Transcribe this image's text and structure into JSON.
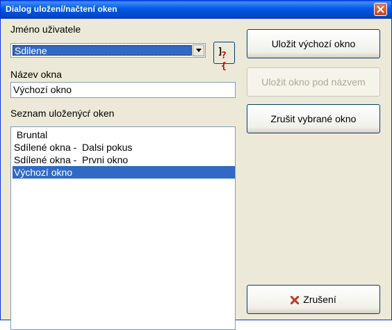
{
  "window": {
    "title": "Dialog uložení/načtení oken"
  },
  "user": {
    "label": "Jméno uživatele",
    "selected": "Sdilene"
  },
  "help_button": {
    "text": "?{"
  },
  "window_name": {
    "label": "Název okna",
    "value": "Výchozí okno"
  },
  "saved_list": {
    "label": "Seznam uloženýcŕ oken",
    "items": [
      " Bruntal",
      "Sdílené okna -  Dalsi pokus",
      "Sdílené okna -  Prvni okno",
      "Výchozí okno"
    ],
    "selected_index": 3
  },
  "buttons": {
    "save_default": "Uložit výchozí okno",
    "save_named": "Uložit okno pod názvem",
    "delete_selected": "Zrušit vybrané okno",
    "cancel": "Zrušení"
  },
  "colors": {
    "title_bar": "#0058e6",
    "selection": "#316ac5",
    "background": "#ece9d8",
    "cancel_icon": "#c0392b"
  }
}
